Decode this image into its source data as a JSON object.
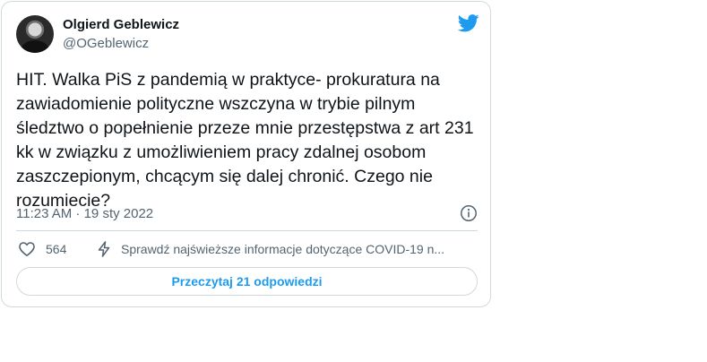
{
  "author": {
    "name": "Olgierd Geblewicz",
    "handle": "@OGeblewicz"
  },
  "tweet": {
    "text": "HIT. Walka PiS z pandemią w praktyce- prokuratura na\nzawiadomienie polityczne wszczyna w trybie pilnym\nśledztwo o popełnienie przeze mnie przestępstwa z art 231\nkk w związku z umożliwieniem pracy zdalnej osobom\nzaszczepionym, chcącym się dalej chronić. Czego nie\nrozumiecie?",
    "timestamp": "11:23 AM · 19 sty 2022"
  },
  "actions": {
    "like_count": "564",
    "covid_info": "Sprawdź najświeższe informacje dotyczące COVID-19 n..."
  },
  "replies_button": {
    "label": "Przeczytaj 21 odpowiedzi"
  },
  "icons": {
    "logo": "twitter-bird-icon",
    "info": "info-icon",
    "like": "heart-icon",
    "covid": "lightning-icon"
  },
  "colors": {
    "brand": "#1d9bf0",
    "text": "#0f1419",
    "secondary": "#536471",
    "border": "#cfd9de"
  }
}
